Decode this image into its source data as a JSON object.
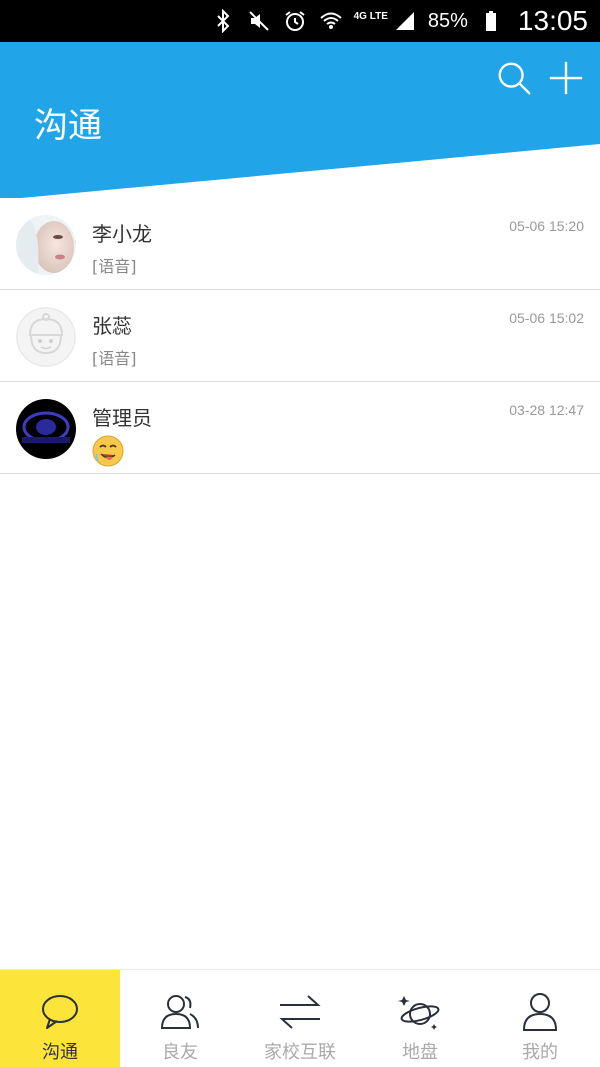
{
  "status_bar": {
    "network": "4G LTE",
    "battery": "85%",
    "time": "13:05",
    "icons": [
      "bluetooth-icon",
      "mute-icon",
      "alarm-icon",
      "wifi-icon",
      "signal-icon",
      "battery-icon"
    ]
  },
  "header": {
    "title": "沟通",
    "background_color": "#21a5e8",
    "actions": [
      "search-icon",
      "plus-icon"
    ]
  },
  "conversations": [
    {
      "name": "李小龙",
      "preview": "[语音]",
      "time": "05-06 15:20",
      "avatar": "photo-avatar"
    },
    {
      "name": "张蕊",
      "preview": "[语音]",
      "time": "05-06 15:02",
      "avatar": "default-avatar"
    },
    {
      "name": "管理员",
      "preview_emoji": "drooling-face-emoji",
      "time": "03-28 12:47",
      "avatar": "logo-avatar"
    }
  ],
  "bottom_nav": {
    "active_color": "#fce43a",
    "items": [
      {
        "label": "沟通",
        "icon": "chat-bubble-icon",
        "active": true
      },
      {
        "label": "良友",
        "icon": "friends-icon",
        "active": false
      },
      {
        "label": "家校互联",
        "icon": "exchange-arrows-icon",
        "active": false
      },
      {
        "label": "地盘",
        "icon": "planet-icon",
        "active": false
      },
      {
        "label": "我的",
        "icon": "person-icon",
        "active": false
      }
    ]
  }
}
